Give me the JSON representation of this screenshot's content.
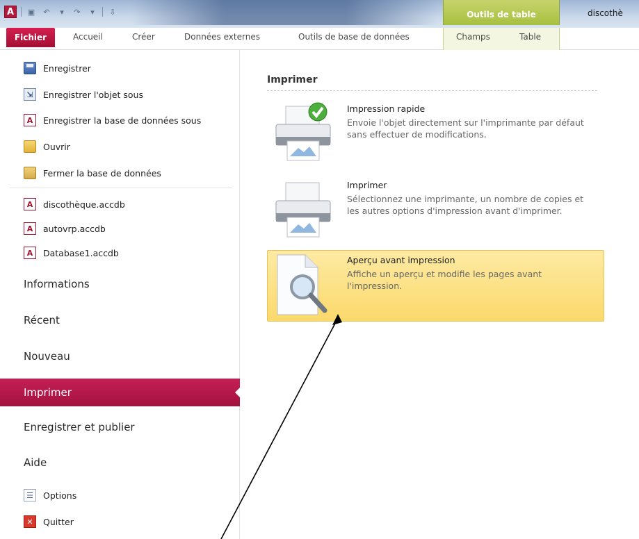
{
  "titlebar": {
    "document_title": "discothè",
    "context_group": "Outils de table"
  },
  "tabs": {
    "file": "Fichier",
    "items": [
      "Accueil",
      "Créer",
      "Données externes",
      "Outils de base de données",
      "Champs",
      "Table"
    ]
  },
  "leftnav": {
    "commands": [
      {
        "label": "Enregistrer",
        "icon": "save-icon"
      },
      {
        "label": "Enregistrer l'objet sous",
        "icon": "save-object-as-icon"
      },
      {
        "label": "Enregistrer la base de données sous",
        "icon": "access-database-icon"
      },
      {
        "label": "Ouvrir",
        "icon": "folder-open-icon"
      },
      {
        "label": "Fermer la base de données",
        "icon": "close-database-icon"
      }
    ],
    "recent_files": [
      {
        "label": "discothèque.accdb",
        "icon": "access-database-icon"
      },
      {
        "label": "autovrp.accdb",
        "icon": "access-database-icon"
      },
      {
        "label": "Database1.accdb",
        "icon": "access-database-icon"
      }
    ],
    "sections": [
      "Informations",
      "Récent",
      "Nouveau",
      "Imprimer",
      "Enregistrer et publier",
      "Aide"
    ],
    "active_section": "Imprimer",
    "bottom": [
      {
        "label": "Options",
        "icon": "options-icon"
      },
      {
        "label": "Quitter",
        "icon": "exit-icon"
      }
    ]
  },
  "panel": {
    "title": "Imprimer",
    "options": [
      {
        "title": "Impression rapide",
        "desc": "Envoie l'objet directement sur l'imprimante par défaut sans effectuer de modifications.",
        "icon": "quick-print-icon"
      },
      {
        "title": "Imprimer",
        "desc": "Sélectionnez une imprimante, un nombre de copies et les autres options d'impression avant d'imprimer.",
        "icon": "printer-icon"
      },
      {
        "title": "Aperçu avant impression",
        "desc": "Affiche un aperçu et modifie les pages avant l'impression.",
        "icon": "print-preview-icon",
        "highlighted": true
      }
    ]
  },
  "colors": {
    "accent": "#b5183a",
    "highlight": "#fbd96b",
    "context_tab": "#a7c040"
  }
}
